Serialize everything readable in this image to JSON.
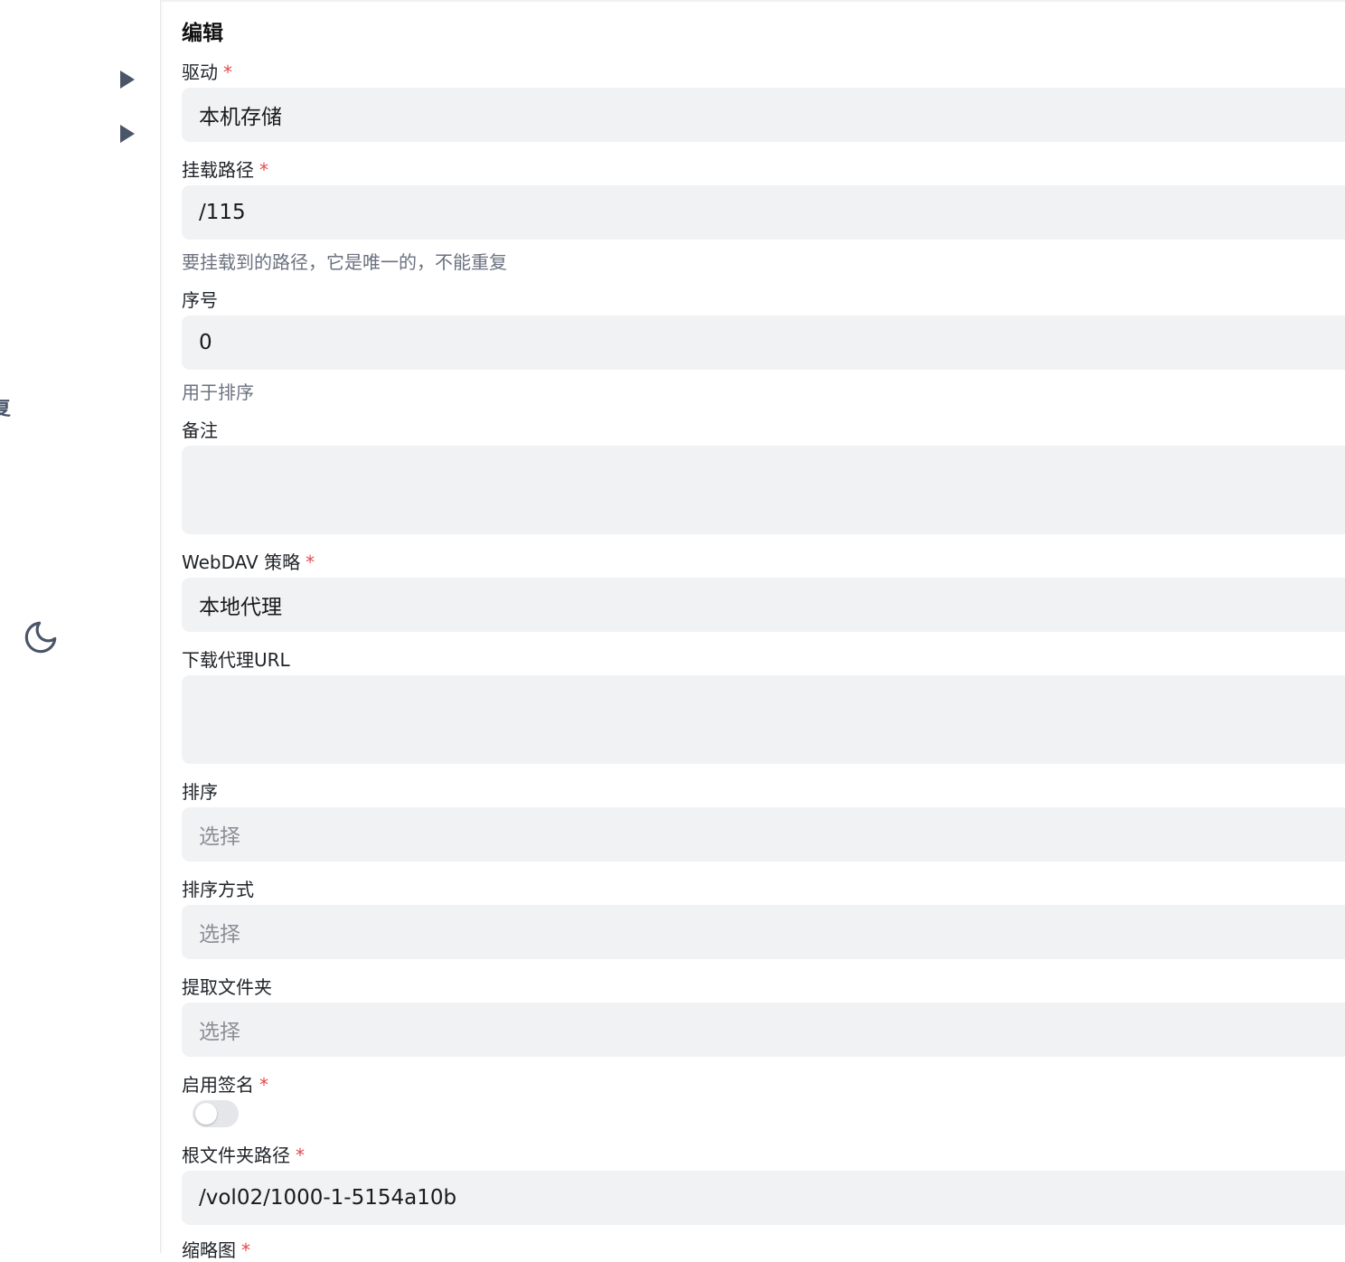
{
  "form": {
    "title": "编辑",
    "required_mark": "*",
    "driver": {
      "label": "驱动",
      "value": "本机存储"
    },
    "mount_path": {
      "label": "挂载路径",
      "value": "/115",
      "hint": "要挂载到的路径，它是唯一的，不能重复"
    },
    "order": {
      "label": "序号",
      "value": "0",
      "hint": "用于排序"
    },
    "remark": {
      "label": "备注",
      "value": ""
    },
    "webdav_policy": {
      "label": "WebDAV 策略",
      "value": "本地代理"
    },
    "download_proxy_url": {
      "label": "下载代理URL",
      "value": ""
    },
    "sort": {
      "label": "排序",
      "placeholder": "选择"
    },
    "sort_direction": {
      "label": "排序方式",
      "placeholder": "选择"
    },
    "extract_folder": {
      "label": "提取文件夹",
      "placeholder": "选择"
    },
    "enable_sign": {
      "label": "启用签名",
      "enabled": false
    },
    "root_folder_path": {
      "label": "根文件夹路径",
      "value": "/vol02/1000-1-5154a10b"
    },
    "thumbnail": {
      "label": "缩略图"
    }
  },
  "sidebar": {
    "partial_text": "复",
    "icons": [
      "caret-right-icon",
      "caret-right-icon",
      "moon-icon"
    ]
  }
}
